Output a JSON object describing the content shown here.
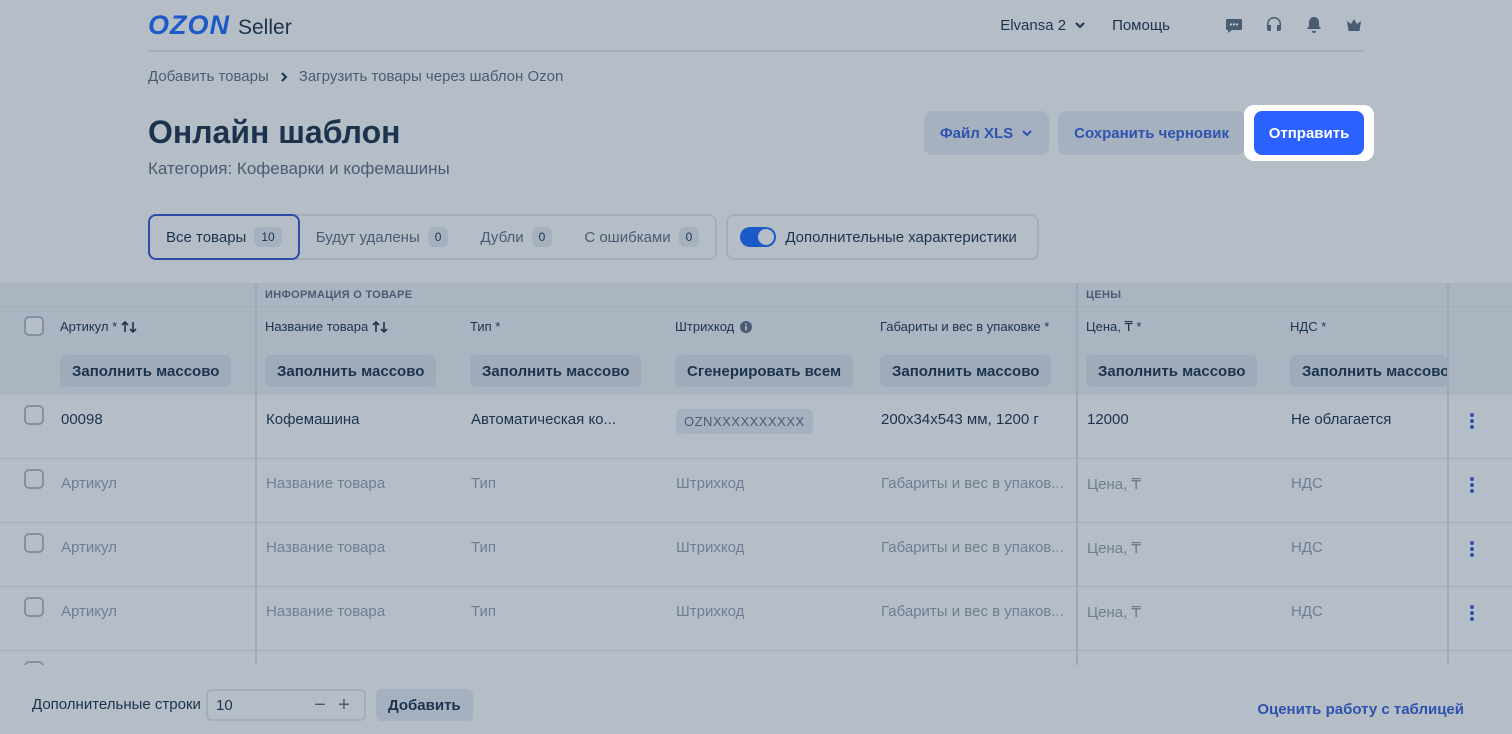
{
  "header": {
    "logo_main": "OZON",
    "logo_sub": "Seller",
    "account_name": "Elvansa 2",
    "help_label": "Помощь",
    "icons": [
      "chat-icon",
      "headset-icon",
      "bell-icon",
      "crown-icon"
    ]
  },
  "breadcrumb": {
    "items": [
      "Добавить товары",
      "Загрузить товары через шаблон Ozon"
    ]
  },
  "page": {
    "title": "Онлайн шаблон",
    "subtitle": "Категория: Кофеварки и кофемашины"
  },
  "actions": {
    "file_label": "Файл XLS",
    "save_draft_label": "Сохранить черновик",
    "submit_label": "Отправить"
  },
  "filters": {
    "tabs": [
      {
        "label": "Все товары",
        "count": "10"
      },
      {
        "label": "Будут удалены",
        "count": "0"
      },
      {
        "label": "Дубли",
        "count": "0"
      },
      {
        "label": "С ошибками",
        "count": "0"
      }
    ],
    "toggle_label": "Дополнительные характеристики"
  },
  "table": {
    "groups": {
      "product_info": "ИНФОРМАЦИЯ О ТОВАРЕ",
      "prices": "ЦЕНЫ"
    },
    "columns": [
      {
        "label": "Артикул *",
        "button": "Заполнить массово"
      },
      {
        "label": "Название товара",
        "button": "Заполнить массово"
      },
      {
        "label": "Тип *",
        "button": "Заполнить массово"
      },
      {
        "label": "Штрихкод",
        "button": "Сгенерировать всем"
      },
      {
        "label": "Габариты и вес в упаковке *",
        "button": "Заполнить массово"
      },
      {
        "label": "Цена, ₸ *",
        "button": "Заполнить массово"
      },
      {
        "label": "НДС *",
        "button": "Заполнить массово"
      }
    ],
    "first_row": {
      "sku": "00098",
      "name": "Кофемашина",
      "type": "Автоматическая ко...",
      "barcode": "OZNXXXXXXXXXX",
      "dimensions": "200x34x543 мм, 1200 г",
      "price": "12000",
      "vat": "Не облагается"
    },
    "placeholders": {
      "sku": "Артикул",
      "name": "Название товара",
      "type": "Тип",
      "barcode": "Штрихкод",
      "dimensions": "Габариты и вес в упаков...",
      "price": "Цена, ₸",
      "vat": "НДС"
    }
  },
  "footer": {
    "extra_rows_label": "Дополнительные строки",
    "extra_rows_value": "10",
    "add_label": "Добавить",
    "rate_link": "Оценить работу с таблицей"
  },
  "colors": {
    "brand": "#005bff",
    "link": "#1f4fd6",
    "overlay": "#465a73"
  }
}
